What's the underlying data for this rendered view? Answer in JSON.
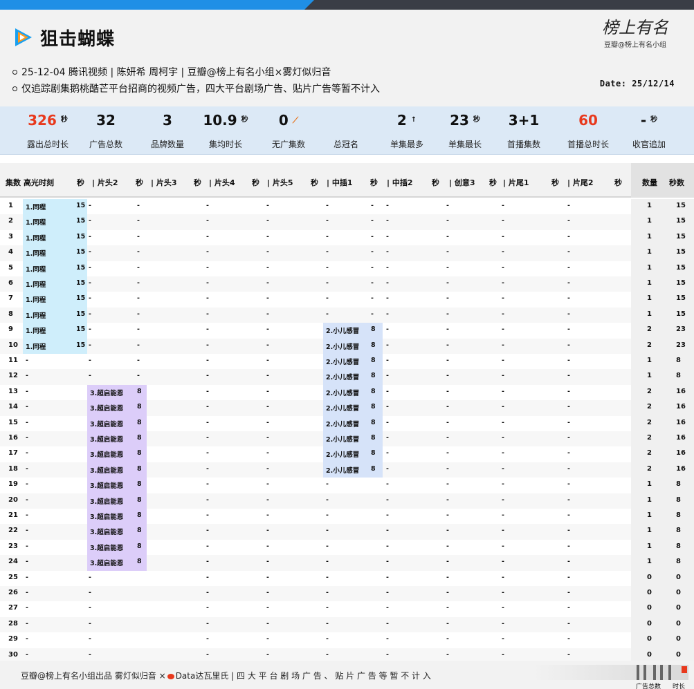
{
  "header": {
    "title": "狙击蝴蝶",
    "brand_sig": "榜上有名",
    "brand_sub": "豆瓣@榜上有名小组",
    "info1": "25-12-04 腾讯视频  |  陈妍希 周柯宇 | 豆瓣@榜上有名小组×雾灯似归音",
    "info2": "仅追踪剧集鹅桃酷芒平台招商的视频广告，四大平台剧场广告、贴片广告等暂不计入",
    "date": "Date: 25/12/14",
    "colors": {
      "top_blue": "#1f8fe6",
      "top_dark": "#3a3d46",
      "accent_red": "#e8391d"
    }
  },
  "stats": [
    {
      "value": "326",
      "unit": "秒",
      "label": "露出总时长",
      "red": true
    },
    {
      "value": "32",
      "unit": "",
      "label": "广告总数",
      "red": false
    },
    {
      "value": "3",
      "unit": "",
      "label": "品牌数量",
      "red": false
    },
    {
      "value": "10.9",
      "unit": "秒",
      "label": "集均时长",
      "red": false
    },
    {
      "value": "0",
      "unit": "",
      "label": "无广集数",
      "red": false,
      "icon": "carrot-icon"
    },
    {
      "value": "",
      "unit": "",
      "label": "总冠名",
      "red": false
    },
    {
      "value": "2",
      "unit": "↑",
      "label": "单集最多",
      "red": false
    },
    {
      "value": "23",
      "unit": "秒",
      "label": "单集最长",
      "red": false
    },
    {
      "value": "3+1",
      "unit": "",
      "label": "首播集数",
      "red": false
    },
    {
      "value": "60",
      "unit": "",
      "label": "首播总时长",
      "red": true
    },
    {
      "value": "-",
      "unit": "秒",
      "label": "收官追加",
      "red": false
    }
  ],
  "table": {
    "headers": [
      "集数",
      "高光时刻",
      "秒",
      "| 片头2",
      "秒",
      "| 片头3",
      "秒",
      "| 片头4",
      "秒",
      "| 片头5",
      "秒",
      "| 中插1",
      "秒",
      "| 中插2",
      "秒",
      "| 创意3",
      "秒",
      "| 片尾1",
      "秒",
      "| 片尾2",
      "秒",
      "数量",
      "秒数"
    ],
    "rows": [
      [
        "1",
        "1.同程",
        "15",
        "-",
        "-",
        "-",
        "-",
        "-",
        "-",
        "-",
        "-",
        "-",
        "1",
        "15"
      ],
      [
        "2",
        "1.同程",
        "15",
        "-",
        "-",
        "-",
        "-",
        "-",
        "-",
        "-",
        "-",
        "-",
        "1",
        "15"
      ],
      [
        "3",
        "1.同程",
        "15",
        "-",
        "-",
        "-",
        "-",
        "-",
        "-",
        "-",
        "-",
        "-",
        "1",
        "15"
      ],
      [
        "4",
        "1.同程",
        "15",
        "-",
        "-",
        "-",
        "-",
        "-",
        "-",
        "-",
        "-",
        "-",
        "1",
        "15"
      ],
      [
        "5",
        "1.同程",
        "15",
        "-",
        "-",
        "-",
        "-",
        "-",
        "-",
        "-",
        "-",
        "-",
        "1",
        "15"
      ],
      [
        "6",
        "1.同程",
        "15",
        "-",
        "-",
        "-",
        "-",
        "-",
        "-",
        "-",
        "-",
        "-",
        "1",
        "15"
      ],
      [
        "7",
        "1.同程",
        "15",
        "-",
        "-",
        "-",
        "-",
        "-",
        "-",
        "-",
        "-",
        "-",
        "1",
        "15"
      ],
      [
        "8",
        "1.同程",
        "15",
        "-",
        "-",
        "-",
        "-",
        "-",
        "-",
        "-",
        "-",
        "-",
        "1",
        "15"
      ],
      [
        "9",
        "1.同程",
        "15",
        "-",
        "-",
        "-",
        "-",
        "2.小儿感冒",
        "8",
        "-",
        "-",
        "-",
        "2",
        "23"
      ],
      [
        "10",
        "1.同程",
        "15",
        "-",
        "-",
        "-",
        "-",
        "2.小儿感冒",
        "8",
        "-",
        "-",
        "-",
        "2",
        "23"
      ],
      [
        "11",
        "-",
        "",
        "-",
        "-",
        "-",
        "-",
        "2.小儿感冒",
        "8",
        "-",
        "-",
        "-",
        "1",
        "8"
      ],
      [
        "12",
        "-",
        "",
        "-",
        "-",
        "-",
        "-",
        "2.小儿感冒",
        "8",
        "-",
        "-",
        "-",
        "1",
        "8"
      ],
      [
        "13",
        "-",
        "",
        "3.超启能恩",
        "8",
        "-",
        "-",
        "2.小儿感冒",
        "8",
        "-",
        "-",
        "-",
        "2",
        "16"
      ],
      [
        "14",
        "-",
        "",
        "3.超启能恩",
        "8",
        "-",
        "-",
        "2.小儿感冒",
        "8",
        "-",
        "-",
        "-",
        "2",
        "16"
      ],
      [
        "15",
        "-",
        "",
        "3.超启能恩",
        "8",
        "-",
        "-",
        "2.小儿感冒",
        "8",
        "-",
        "-",
        "-",
        "2",
        "16"
      ],
      [
        "16",
        "-",
        "",
        "3.超启能恩",
        "8",
        "-",
        "-",
        "2.小儿感冒",
        "8",
        "-",
        "-",
        "-",
        "2",
        "16"
      ],
      [
        "17",
        "-",
        "",
        "3.超启能恩",
        "8",
        "-",
        "-",
        "2.小儿感冒",
        "8",
        "-",
        "-",
        "-",
        "2",
        "16"
      ],
      [
        "18",
        "-",
        "",
        "3.超启能恩",
        "8",
        "-",
        "-",
        "2.小儿感冒",
        "8",
        "-",
        "-",
        "-",
        "2",
        "16"
      ],
      [
        "19",
        "-",
        "",
        "3.超启能恩",
        "8",
        "-",
        "-",
        "-",
        "",
        "-",
        "-",
        "-",
        "1",
        "8"
      ],
      [
        "20",
        "-",
        "",
        "3.超启能恩",
        "8",
        "-",
        "-",
        "-",
        "",
        "-",
        "-",
        "-",
        "1",
        "8"
      ],
      [
        "21",
        "-",
        "",
        "3.超启能恩",
        "8",
        "-",
        "-",
        "-",
        "",
        "-",
        "-",
        "-",
        "1",
        "8"
      ],
      [
        "22",
        "-",
        "",
        "3.超启能恩",
        "8",
        "-",
        "-",
        "-",
        "",
        "-",
        "-",
        "-",
        "1",
        "8"
      ],
      [
        "23",
        "-",
        "",
        "3.超启能恩",
        "8",
        "-",
        "-",
        "-",
        "",
        "-",
        "-",
        "-",
        "1",
        "8"
      ],
      [
        "24",
        "-",
        "",
        "3.超启能恩",
        "8",
        "-",
        "-",
        "-",
        "",
        "-",
        "-",
        "-",
        "1",
        "8"
      ],
      [
        "25",
        "-",
        "",
        "-",
        "",
        "-",
        "-",
        "-",
        "",
        "-",
        "-",
        "-",
        "0",
        "0"
      ],
      [
        "26",
        "-",
        "",
        "-",
        "",
        "-",
        "-",
        "-",
        "",
        "-",
        "-",
        "-",
        "0",
        "0"
      ],
      [
        "27",
        "-",
        "",
        "-",
        "",
        "-",
        "-",
        "-",
        "",
        "-",
        "-",
        "-",
        "0",
        "0"
      ],
      [
        "28",
        "-",
        "",
        "-",
        "",
        "-",
        "-",
        "-",
        "",
        "-",
        "-",
        "-",
        "0",
        "0"
      ],
      [
        "29",
        "-",
        "",
        "-",
        "",
        "-",
        "-",
        "-",
        "",
        "-",
        "-",
        "-",
        "0",
        "0"
      ],
      [
        "30",
        "-",
        "",
        "-",
        "",
        "-",
        "-",
        "-",
        "",
        "-",
        "-",
        "-",
        "0",
        "0"
      ]
    ]
  },
  "footer": {
    "text_a": "豆瓣@榜上有名小组出品  雾灯似归音 ×",
    "text_b": "Data达瓦里氏 | 四 大 平 台 剧 场 广 告 、 贴 片 广 告 等 暂 不 计 入",
    "label_count": "广告总数",
    "label_time": "时长"
  }
}
